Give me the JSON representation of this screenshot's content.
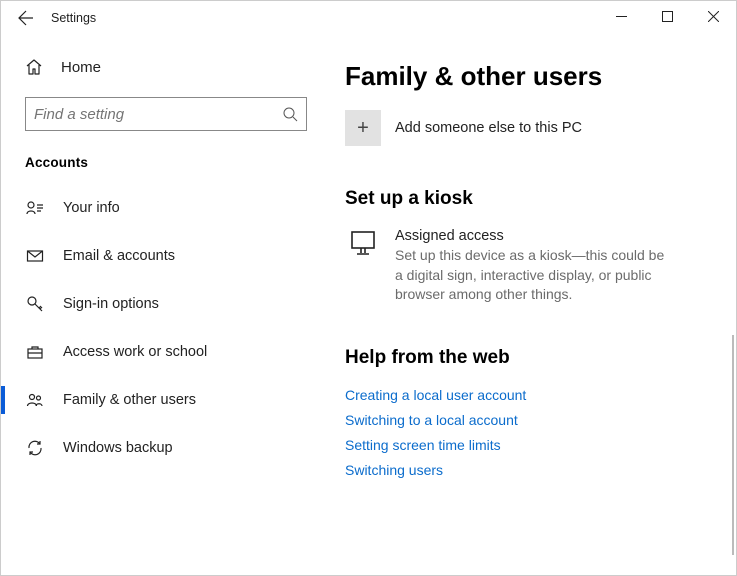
{
  "window": {
    "title": "Settings"
  },
  "sidebar": {
    "home_label": "Home",
    "search_placeholder": "Find a setting",
    "section_title": "Accounts",
    "items": [
      {
        "label": "Your info"
      },
      {
        "label": "Email & accounts"
      },
      {
        "label": "Sign-in options"
      },
      {
        "label": "Access work or school"
      },
      {
        "label": "Family & other users"
      },
      {
        "label": "Windows backup"
      }
    ]
  },
  "main": {
    "page_title": "Family & other users",
    "add_label": "Add someone else to this PC",
    "kiosk": {
      "heading": "Set up a kiosk",
      "title": "Assigned access",
      "desc": "Set up this device as a kiosk—this could be a digital sign, interactive display, or public browser among other things."
    },
    "help": {
      "heading": "Help from the web",
      "links": [
        "Creating a local user account",
        "Switching to a local account",
        "Setting screen time limits",
        "Switching users"
      ]
    }
  }
}
